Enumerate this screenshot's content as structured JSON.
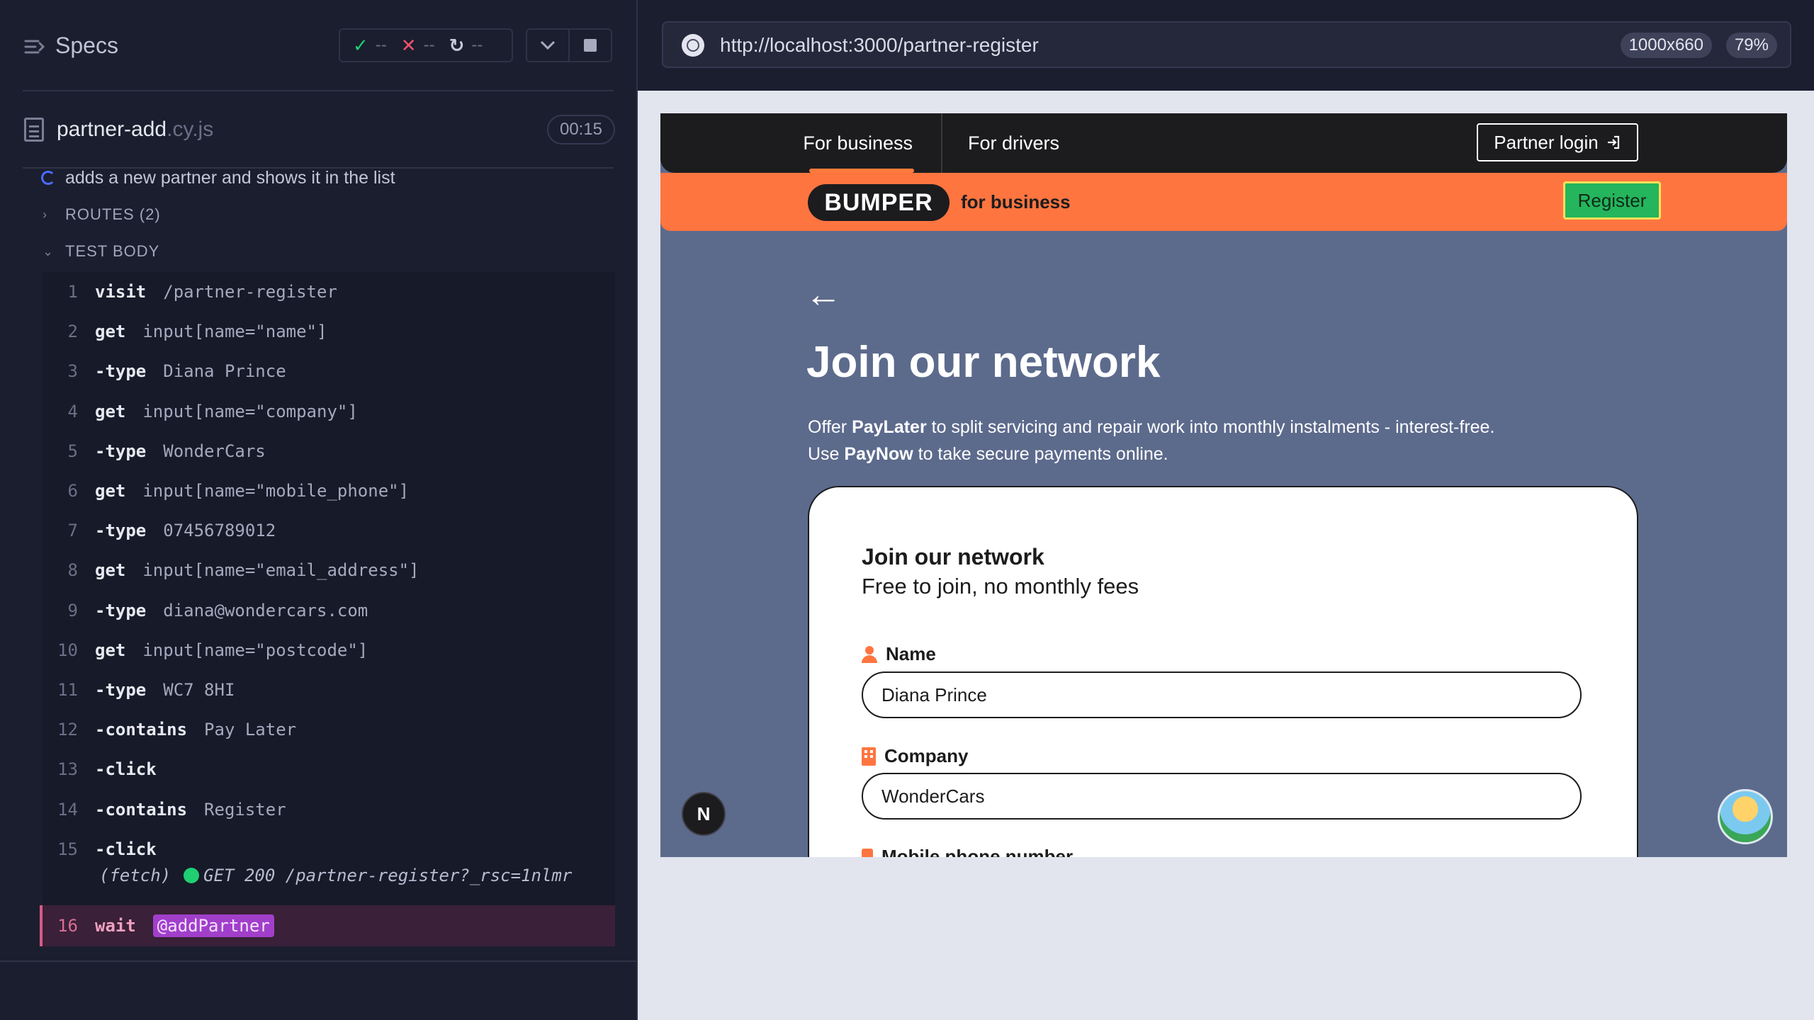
{
  "runner": {
    "specs_label": "Specs",
    "stats": {
      "passed": "--",
      "failed": "--",
      "pending": "--"
    },
    "spec": {
      "file_name": "partner-add",
      "file_ext": ".cy.js",
      "duration": "00:15"
    },
    "test_title": "adds a new partner and shows it in the list",
    "routes_label": "ROUTES (2)",
    "test_body_label": "TEST BODY",
    "commands": [
      {
        "num": "1",
        "name": "visit",
        "msg": "/partner-register",
        "child": false
      },
      {
        "num": "2",
        "name": "get",
        "msg": "input[name=\"name\"]",
        "child": false
      },
      {
        "num": "3",
        "name": "-type",
        "msg": "Diana Prince",
        "child": true
      },
      {
        "num": "4",
        "name": "get",
        "msg": "input[name=\"company\"]",
        "child": false
      },
      {
        "num": "5",
        "name": "-type",
        "msg": "WonderCars",
        "child": true
      },
      {
        "num": "6",
        "name": "get",
        "msg": "input[name=\"mobile_phone\"]",
        "child": false
      },
      {
        "num": "7",
        "name": "-type",
        "msg": "07456789012",
        "child": true
      },
      {
        "num": "8",
        "name": "get",
        "msg": "input[name=\"email_address\"]",
        "child": false
      },
      {
        "num": "9",
        "name": "-type",
        "msg": "diana@wondercars.com",
        "child": true
      },
      {
        "num": "10",
        "name": "get",
        "msg": "input[name=\"postcode\"]",
        "child": false
      },
      {
        "num": "11",
        "name": "-type",
        "msg": "WC7 8HI",
        "child": true
      },
      {
        "num": "12",
        "name": "-contains",
        "msg": "Pay Later",
        "child": true
      },
      {
        "num": "13",
        "name": "-click",
        "msg": "",
        "child": true
      },
      {
        "num": "14",
        "name": "-contains",
        "msg": "Register",
        "child": true
      },
      {
        "num": "15",
        "name": "-click",
        "msg": "",
        "child": true
      }
    ],
    "fetch": {
      "label": "(fetch)",
      "request": "GET 200 /partner-register?_rsc=1nlmr"
    },
    "wait": {
      "num": "16",
      "name": "wait",
      "alias": "@addPartner"
    }
  },
  "aut": {
    "url": "http://localhost:3000/partner-register",
    "viewport": "1000x660",
    "zoom": "79%",
    "app": {
      "nav": {
        "tab_business": "For business",
        "tab_drivers": "For drivers",
        "partner_login": "Partner login"
      },
      "brand": {
        "logo": "BUMPER",
        "tagline": "for business",
        "register": "Register"
      },
      "hero": {
        "back": "←",
        "title": "Join our network",
        "desc_1_pre": "Offer ",
        "desc_1_bold": "PayLater",
        "desc_1_post": " to split servicing and repair work into monthly instalments - interest-free.",
        "desc_2_pre": "Use ",
        "desc_2_bold": "PayNow",
        "desc_2_post": " to take secure payments online."
      },
      "form": {
        "title": "Join our network",
        "subtitle": "Free to join, no monthly fees",
        "name_label": "Name",
        "name_value": "Diana Prince",
        "company_label": "Company",
        "company_value": "WonderCars",
        "mobile_label": "Mobile phone number"
      },
      "next_badge": "N"
    }
  }
}
